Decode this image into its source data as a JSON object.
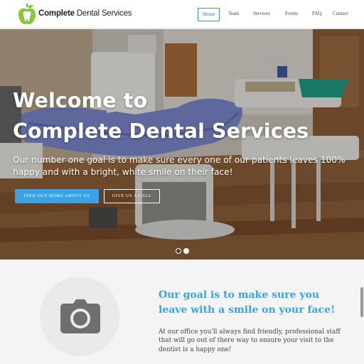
{
  "brand": {
    "name_bold": "Complete",
    "name_rest": " Dental Services",
    "logo_icon": "apple-tooth-logo"
  },
  "nav": {
    "items": [
      {
        "label": "Home",
        "active": true
      },
      {
        "label": "Team",
        "active": false
      },
      {
        "label": "Services",
        "active": false
      },
      {
        "label": "Forms",
        "active": false
      },
      {
        "label": "FAQ",
        "active": false
      },
      {
        "label": "Contact",
        "active": false
      }
    ]
  },
  "hero": {
    "title_line1": "Welcome to",
    "title_line2": "Complete Dental Services",
    "text": "Our number one goal is to make sure every one of our patients leaves 100% happy and with a bright, white smile on their face!",
    "primary_button": "FIND OUT MORE ABOUT US",
    "secondary_button": "GIVE US A CALL",
    "slider_active_index": 1,
    "slides_count": 2
  },
  "goal": {
    "title": "Our goal is to make sure you leave with a smile on your face!",
    "text": "At our office you'll always find friendly, professional staff that will go out of there way to ensure your visit to the dentist is a happy one!",
    "image_icon": "camera-icon"
  },
  "colors": {
    "accent": "#3aa3e8",
    "nav_active": "#2d7fc8",
    "logo_green": "#8cc63f"
  }
}
